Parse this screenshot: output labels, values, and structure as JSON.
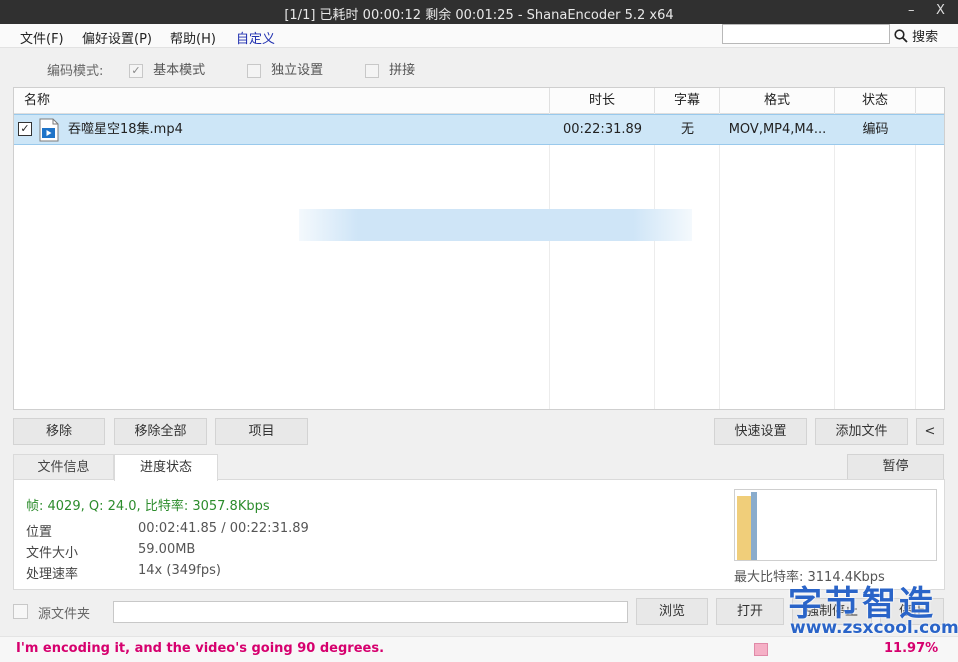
{
  "window": {
    "title": "[1/1] 已耗时 00:00:12  剩余 00:01:25 - ShanaEncoder 5.2 x64",
    "minimize_glyph": "–",
    "close_glyph": "X"
  },
  "menu": {
    "items": [
      "文件(F)",
      "偏好设置(P)",
      "帮助(H)",
      "自定义"
    ],
    "search_value": "",
    "search_label": "搜索"
  },
  "mode": {
    "label": "编码模式:",
    "options": [
      "基本模式",
      "独立设置",
      "拼接"
    ],
    "checked": [
      true,
      false,
      false
    ]
  },
  "file_list": {
    "columns": [
      "名称",
      "时长",
      "字幕",
      "格式",
      "状态"
    ],
    "rows": [
      {
        "checked": true,
        "name": "吞噬星空18集.mp4",
        "duration": "00:22:31.89",
        "subtitle": "无",
        "format": "MOV,MP4,M4...",
        "status": "编码"
      }
    ]
  },
  "buttons": {
    "remove": "移除",
    "remove_all": "移除全部",
    "item": "项目",
    "quick_settings": "快速设置",
    "add_file": "添加文件",
    "collapse": "<"
  },
  "tabs": {
    "file_info": "文件信息",
    "progress_state": "进度状态",
    "pause": "暂停"
  },
  "progress": {
    "summary": "帧: 4029, Q: 24.0, 比特率: 3057.8Kbps",
    "position_label": "位置",
    "position_value": "00:02:41.85 / 00:22:31.89",
    "size_label": "文件大小",
    "size_value": "59.00MB",
    "speed_label": "处理速率",
    "speed_value": "14x (349fps)",
    "max_bitrate": "最大比特率: 3114.4Kbps",
    "graph_fill_fraction": 0.12
  },
  "output": {
    "source_folder_label": "源文件夹",
    "source_folder_checked": false,
    "path_value": "",
    "browse": "浏览",
    "open": "打开",
    "force_stop": "强制停止",
    "stop": "停止"
  },
  "status": {
    "message": "I'm encoding it, and the video's going 90 degrees.",
    "percent": "11.97%"
  },
  "watermark": {
    "text_cn": "字节智造",
    "text_url": "www.zsxcool.com"
  },
  "colors": {
    "titlebar_bg": "#303030",
    "selection_bg": "#cde6f7",
    "green_text": "#2c8c2c",
    "status_magenta": "#d6006e",
    "watermark_blue": "#2a64c8"
  }
}
